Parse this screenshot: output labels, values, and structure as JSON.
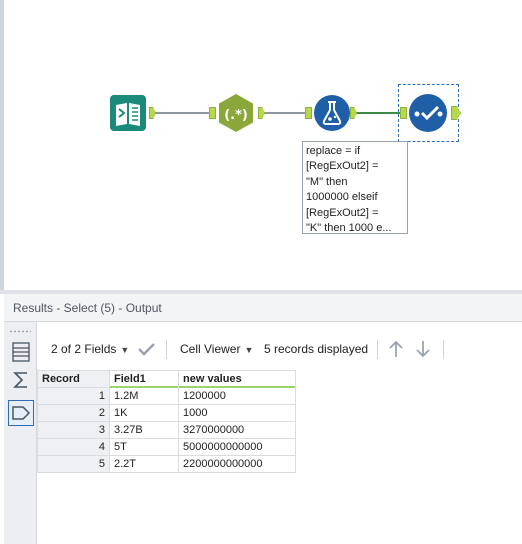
{
  "canvas": {
    "annotation": "replace = if\n[RegExOut2] =\n\"M\" then\n1000000 elseif\n[RegExOut2] =\n\"K\" then 1000 e..."
  },
  "colors": {
    "input_tool": "#1b8a7a",
    "regex_tool": "#8aa83a",
    "formula_tool": "#1f5fa8",
    "select_tool": "#1f5fa8",
    "anchor": "#b6d94c",
    "selection": "#2d6db5"
  },
  "icons": [
    "book-icon",
    "regex-icon",
    "flask-icon",
    "checkmark-flow-icon",
    "table-icon",
    "sum-icon",
    "tag-icon",
    "checkmark-icon",
    "arrow-up-icon",
    "arrow-down-icon"
  ],
  "results": {
    "title": "Results - Select (5) - Output",
    "toolbar": {
      "fields": "2 of 2 Fields",
      "cell_viewer": "Cell Viewer",
      "records_displayed": "5 records displayed"
    },
    "table": {
      "headers": [
        "Record",
        "Field1",
        "new values"
      ],
      "rows": [
        [
          "1",
          "1.2M",
          "1200000"
        ],
        [
          "2",
          "1K",
          "1000"
        ],
        [
          "3",
          "3.27B",
          "3270000000"
        ],
        [
          "4",
          "5T",
          "5000000000000"
        ],
        [
          "5",
          "2.2T",
          "2200000000000"
        ]
      ]
    }
  }
}
